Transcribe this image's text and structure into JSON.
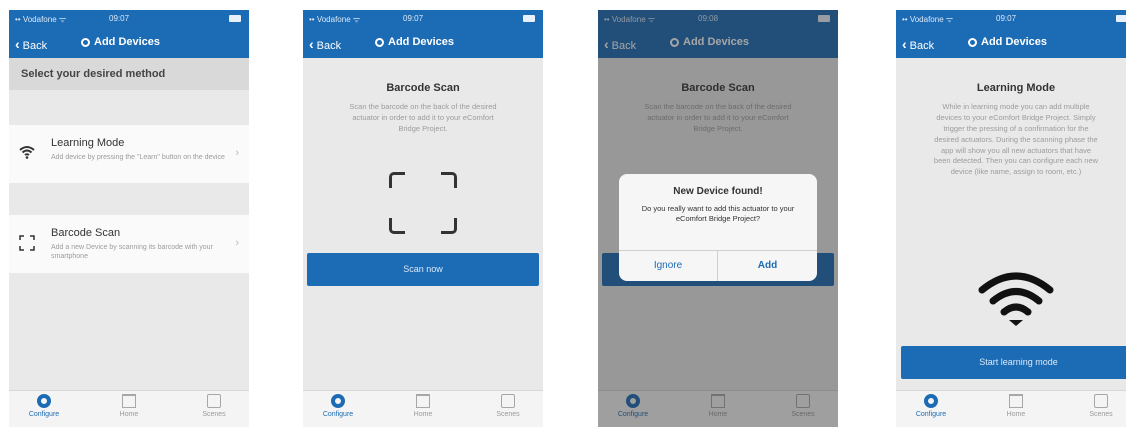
{
  "status": {
    "carrier": "•• Vodafone ᯤ",
    "times": [
      "09:07",
      "09:07",
      "09:08",
      "09:07"
    ]
  },
  "nav": {
    "back": "Back",
    "title": "Add Devices"
  },
  "tabs": [
    "Configure",
    "Home",
    "Scenes"
  ],
  "screen1": {
    "header": "Select your desired method",
    "options": [
      {
        "title": "Learning Mode",
        "desc": "Add device by pressing the \"Learn\" button on the device",
        "icon": "wifi-icon"
      },
      {
        "title": "Barcode Scan",
        "desc": "Add a new Device by scanning its barcode with your smartphone",
        "icon": "scan-frame-icon"
      }
    ]
  },
  "screen2": {
    "title": "Barcode Scan",
    "text": "Scan the barcode on the back of the desired actuator in order to add it to your eComfort Bridge Project.",
    "button": "Scan now"
  },
  "screen3": {
    "alert_title": "New Device found!",
    "alert_message": "Do you really want to add this actuator to your eComfort Bridge Project?",
    "ignore": "Ignore",
    "add": "Add"
  },
  "screen4": {
    "title": "Learning Mode",
    "text": "While in learning mode you can add multiple devices to your eComfort Bridge Project. Simply trigger the pressing of a confirmation for the desired actuators. During the scanning phase the app will show you all new actuators that have been detected. Then you can configure each new device (like name, assign to room, etc.)",
    "button": "Start learning mode"
  },
  "colors": {
    "accent": "#1c6bb5"
  }
}
